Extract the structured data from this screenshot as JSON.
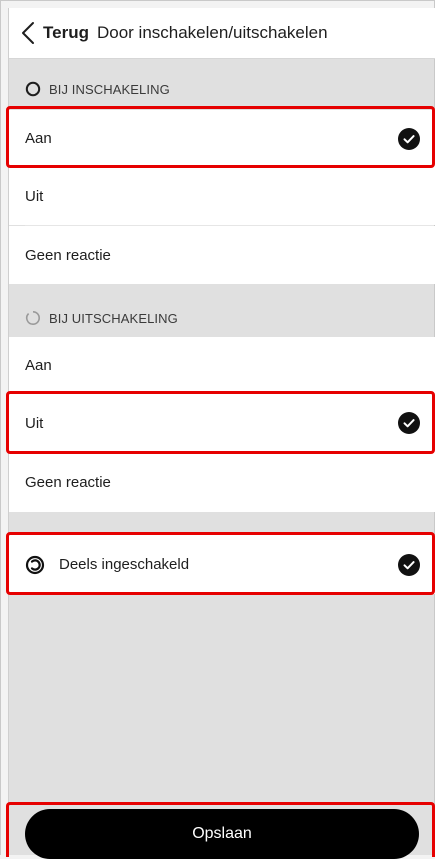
{
  "header": {
    "back_label": "Terug",
    "title": "Door inschakelen/uitschakelen"
  },
  "sections": {
    "on": {
      "label": "BIJ INSCHAKELING",
      "icon": "circle-outline-icon",
      "options": [
        "Aan",
        "Uit",
        "Geen reactie"
      ],
      "selected": "Aan"
    },
    "off": {
      "label": "BIJ UITSCHAKELING",
      "icon": "partial-circle-icon",
      "options": [
        "Aan",
        "Uit",
        "Geen reactie"
      ],
      "selected": "Uit"
    }
  },
  "partial": {
    "label": "Deels ingeschakeld",
    "icon": "partially-armed-icon",
    "selected": true
  },
  "footer": {
    "save_label": "Opslaan"
  },
  "colors": {
    "highlight": "#e60000",
    "button_bg": "#000000",
    "panel_bg": "#e0e0e0"
  }
}
